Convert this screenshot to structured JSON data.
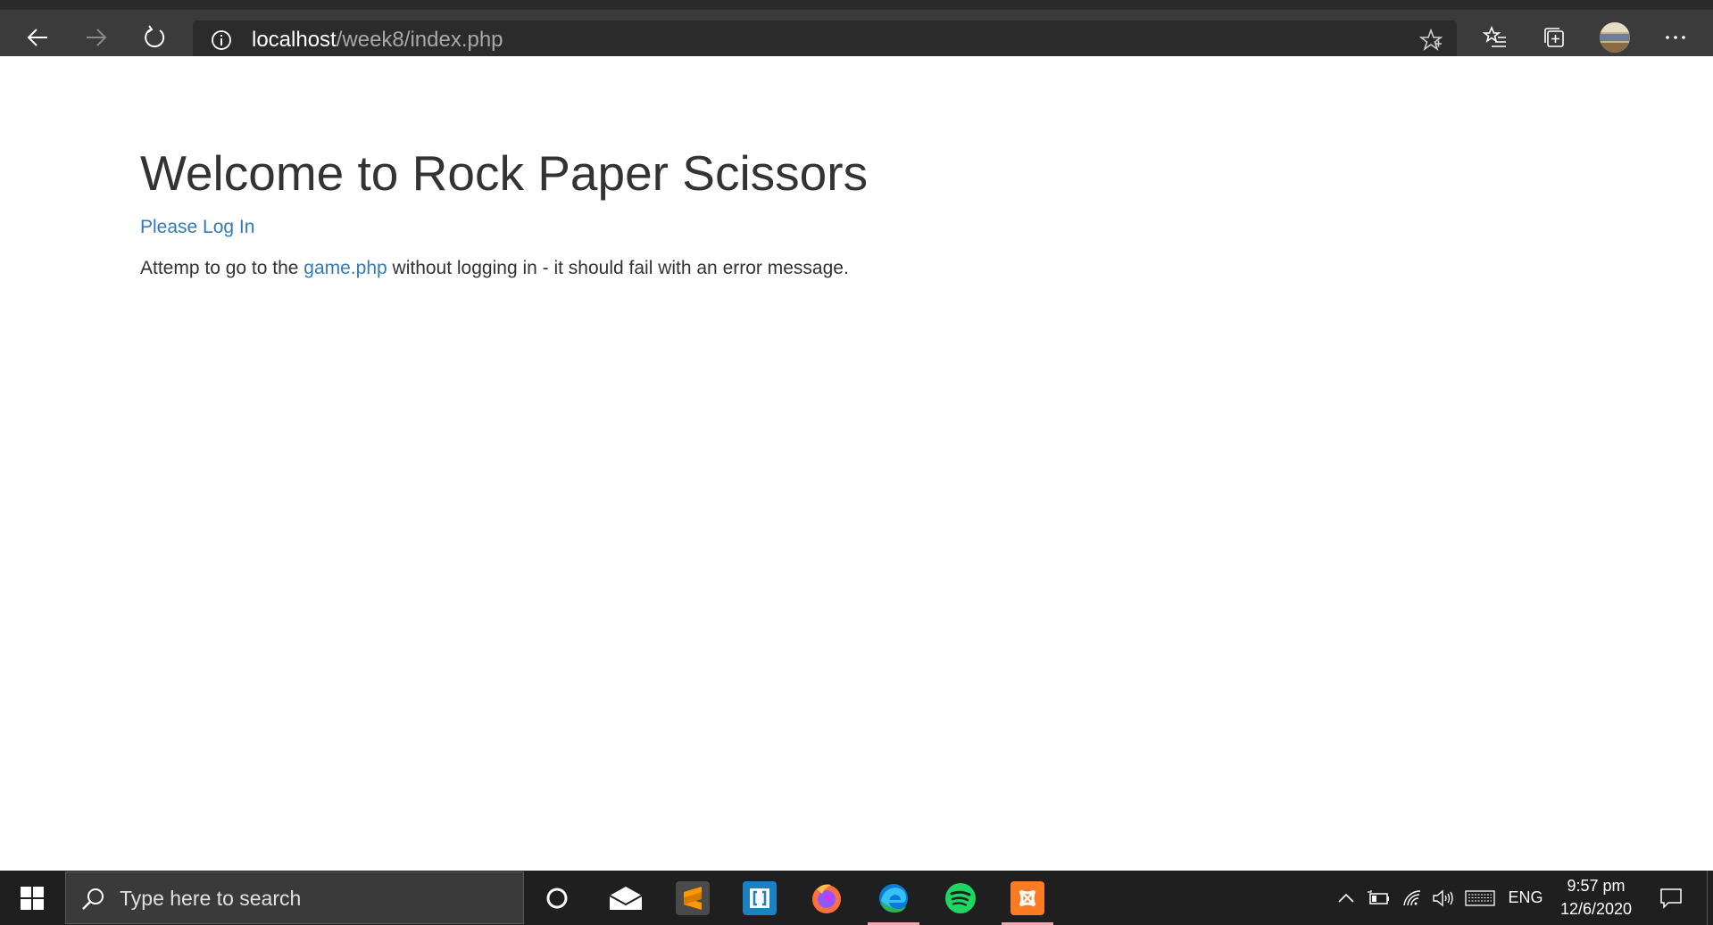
{
  "browser": {
    "url_host": "localhost",
    "url_path": "/week8/index.php",
    "icons": {
      "back": "back-arrow-icon",
      "forward": "forward-arrow-icon",
      "refresh": "refresh-icon",
      "site_info": "info-icon",
      "favorite": "star-icon",
      "favorites": "favorites-list-icon",
      "collections": "collections-icon",
      "profile": "avatar",
      "more": "more-icon"
    }
  },
  "page": {
    "title": "Welcome to Rock Paper Scissors",
    "login_link": "Please Log In",
    "info_before": "Attemp to go to the ",
    "info_link": "game.php",
    "info_after": " without logging in - it should fail with an error message.",
    "link_color": "#337ab7",
    "text_color": "#333333"
  },
  "taskbar": {
    "search_placeholder": "Type here to search",
    "apps": [
      {
        "name": "cortana",
        "icon": "cortana-circle-icon"
      },
      {
        "name": "mail",
        "icon": "mail-icon"
      },
      {
        "name": "sublime-text",
        "icon": "sublime-text-icon",
        "label": "S"
      },
      {
        "name": "brackets",
        "icon": "brackets-icon"
      },
      {
        "name": "firefox",
        "icon": "firefox-icon"
      },
      {
        "name": "edge",
        "icon": "edge-icon",
        "active": true
      },
      {
        "name": "spotify",
        "icon": "spotify-icon"
      },
      {
        "name": "xampp",
        "icon": "xampp-icon",
        "active": true
      }
    ],
    "tray": {
      "language": "ENG",
      "time": "9:57 pm",
      "date": "12/6/2020"
    }
  }
}
